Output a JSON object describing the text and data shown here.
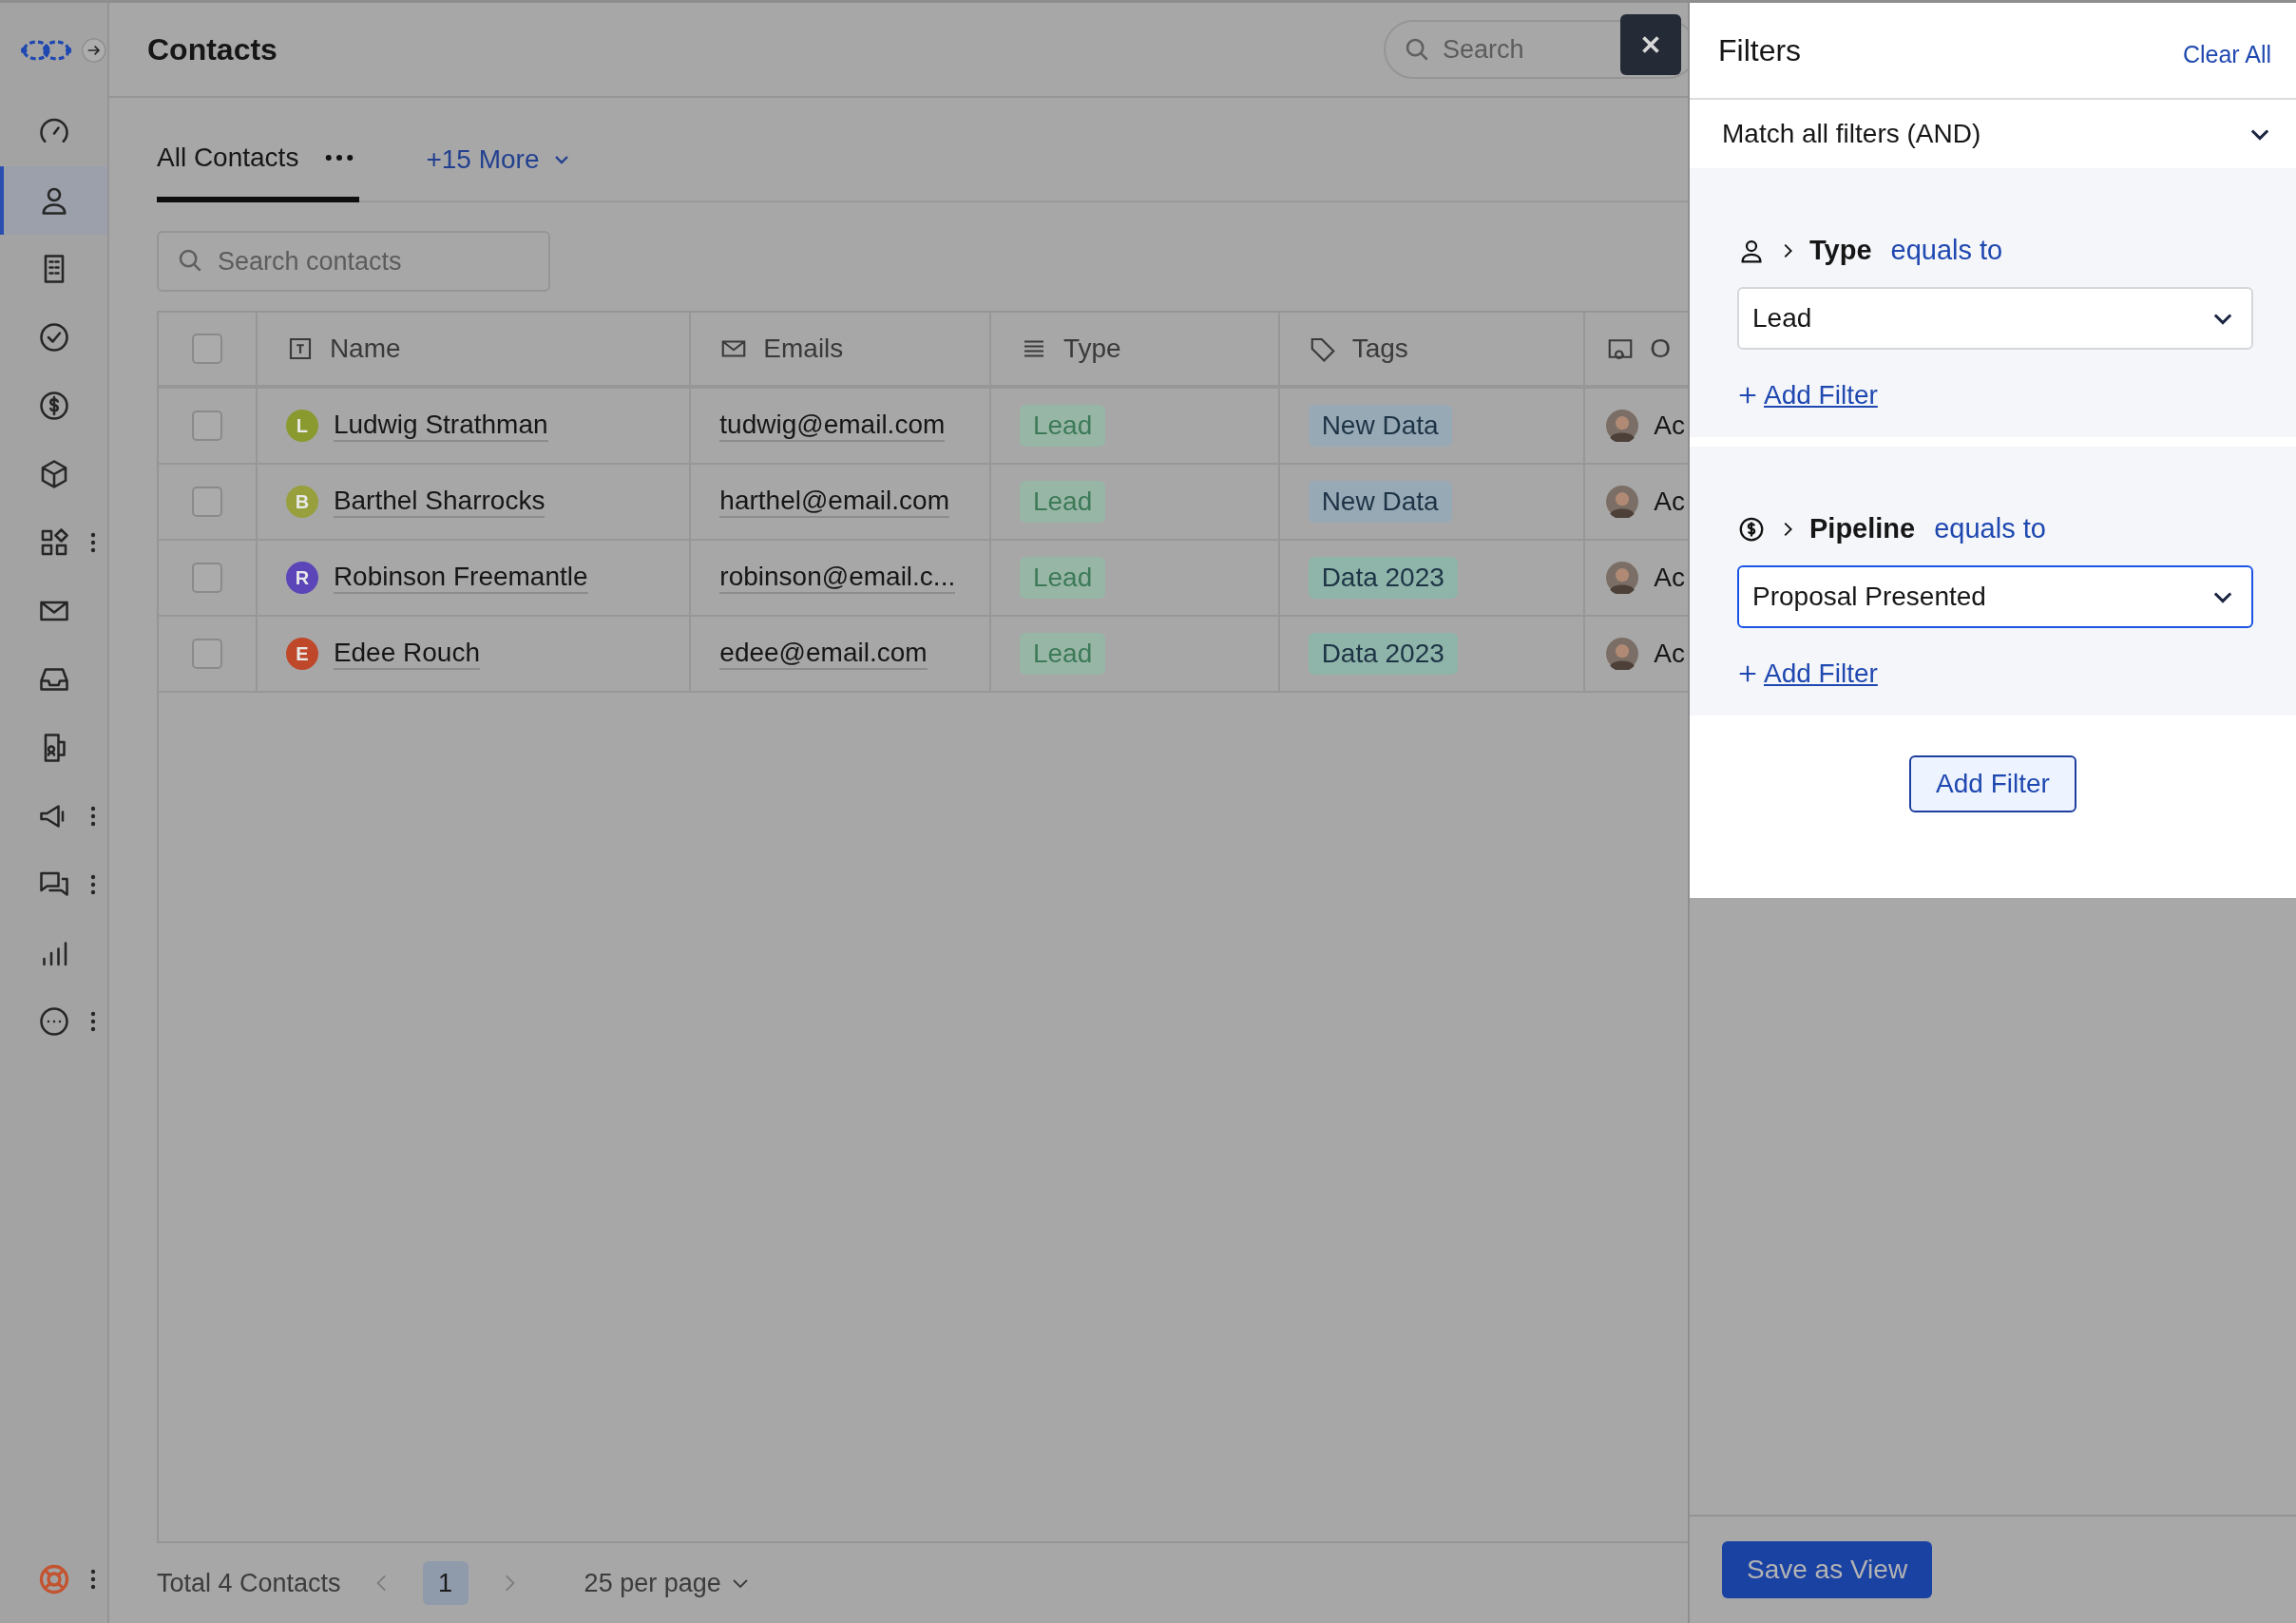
{
  "header": {
    "title": "Contacts",
    "search_placeholder": "Search"
  },
  "sidebar": {
    "items": [
      {
        "kind": "gauge",
        "selected": false,
        "more_menu": false
      },
      {
        "kind": "person",
        "selected": true,
        "more_menu": false
      },
      {
        "kind": "building",
        "selected": false,
        "more_menu": false
      },
      {
        "kind": "check",
        "selected": false,
        "more_menu": false
      },
      {
        "kind": "dollar",
        "selected": false,
        "more_menu": false
      },
      {
        "kind": "cube",
        "selected": false,
        "more_menu": false
      },
      {
        "kind": "apps",
        "selected": false,
        "more_menu": true
      },
      {
        "kind": "mail",
        "selected": false,
        "more_menu": false
      },
      {
        "kind": "inbox",
        "selected": false,
        "more_menu": false
      },
      {
        "kind": "card",
        "selected": false,
        "more_menu": false
      },
      {
        "kind": "megaphone",
        "selected": false,
        "more_menu": true
      },
      {
        "kind": "chat",
        "selected": false,
        "more_menu": true
      },
      {
        "kind": "chart",
        "selected": false,
        "more_menu": false
      },
      {
        "kind": "more",
        "selected": false,
        "more_menu": true
      }
    ],
    "bottom": {
      "kind": "lifebuoy",
      "more_menu": true
    }
  },
  "views": {
    "tabs": [
      {
        "label": "All Contacts",
        "selected": true
      }
    ],
    "more": "+15 More"
  },
  "search": {
    "placeholder": "Search contacts"
  },
  "table": {
    "select_all_checked": false,
    "columns": [
      {
        "label": "Name"
      },
      {
        "label": "Emails"
      },
      {
        "label": "Type"
      },
      {
        "label": "Tags"
      },
      {
        "label": "O"
      }
    ],
    "rows": [
      {
        "checked": false,
        "initial": "L",
        "color": "#8a9a2e",
        "name": "Ludwig Strathman",
        "email": "tudwig@email.com",
        "type": "Lead",
        "tag": {
          "label": "New Data",
          "color": "#98a9b6"
        },
        "owner": "Ac"
      },
      {
        "checked": false,
        "initial": "B",
        "color": "#97a03c",
        "name": "Barthel Sharrocks",
        "email": "harthel@email.com",
        "type": "Lead",
        "tag": {
          "label": "New Data",
          "color": "#98a9b6"
        },
        "owner": "Ac"
      },
      {
        "checked": false,
        "initial": "R",
        "color": "#5b45b8",
        "name": "Robinson Freemantle",
        "email": "robinson@email.c...",
        "type": "Lead",
        "tag": {
          "label": "Data 2023",
          "color": "#8fb4a9"
        },
        "owner": "Ac"
      },
      {
        "checked": false,
        "initial": "E",
        "color": "#c0482a",
        "name": "Edee Rouch",
        "email": "edee@email.com",
        "type": "Lead",
        "tag": {
          "label": "Data 2023",
          "color": "#8fb4a9"
        },
        "owner": "Ac"
      }
    ]
  },
  "footer": {
    "total": "Total 4 Contacts",
    "pages": [
      {
        "label": "1",
        "selected": true
      }
    ],
    "per_page": "25 per page"
  },
  "filters": {
    "title": "Filters",
    "clear": "Clear All",
    "match": "Match all filters (AND)",
    "groups": [
      {
        "field": "Type",
        "operator": "equals to",
        "value": "Lead",
        "focused": false,
        "add": "Add Filter"
      },
      {
        "field": "Pipeline",
        "operator": "equals to",
        "value": "Proposal Presented",
        "focused": true,
        "add": "Add Filter"
      }
    ],
    "add_button": "Add Filter",
    "save": "Save as View"
  }
}
